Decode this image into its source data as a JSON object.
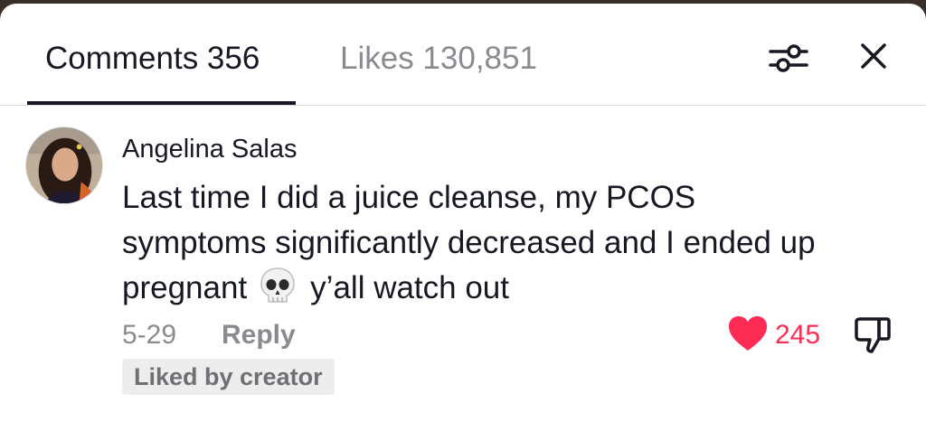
{
  "header": {
    "tabs": [
      {
        "label": "Comments 356",
        "active": true
      },
      {
        "label": "Likes 130,851",
        "active": false
      }
    ],
    "filter_icon": "sliders-icon",
    "close_icon": "close-icon"
  },
  "comment": {
    "username": "Angelina Salas",
    "text_lines": [
      "Last time I did a juice cleanse, my PCOS",
      "symptoms significantly decreased and I ended up",
      "pregnant"
    ],
    "text_after_emoji": "y’all watch out",
    "emoji": "skull-icon",
    "date": "5-29",
    "reply_label": "Reply",
    "like_count": "245",
    "liked": true,
    "badge": "Liked by creator"
  },
  "colors": {
    "primary_text": "#161823",
    "secondary_text": "#8a8b91",
    "like_red": "#fe2c55",
    "badge_bg": "#ededed"
  }
}
